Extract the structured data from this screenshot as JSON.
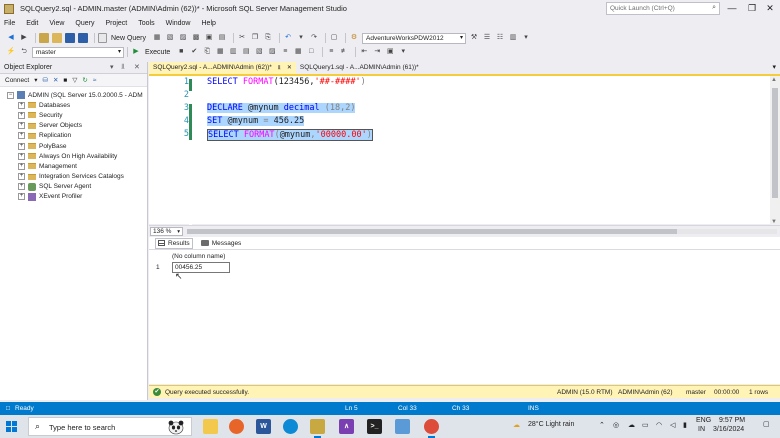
{
  "window": {
    "title": "SQLQuery2.sql - ADMIN.master (ADMIN\\Admin (62))* - Microsoft SQL Server Management Studio",
    "quick_launch_placeholder": "Quick Launch (Ctrl+Q)",
    "controls": [
      "—",
      "❐",
      "✕"
    ]
  },
  "menu": [
    "File",
    "Edit",
    "View",
    "Query",
    "Project",
    "Tools",
    "Window",
    "Help"
  ],
  "toolbar1": {
    "new_query": "New Query",
    "database_combo": "AdventureWorksPDW2012"
  },
  "toolbar2": {
    "db_select": "master",
    "execute": "Execute"
  },
  "object_explorer": {
    "title": "Object Explorer",
    "connect": "Connect",
    "server": "ADMIN (SQL Server 15.0.2000.5 - ADM",
    "nodes": [
      {
        "label": "Databases",
        "icon": "folder"
      },
      {
        "label": "Security",
        "icon": "folder"
      },
      {
        "label": "Server Objects",
        "icon": "folder"
      },
      {
        "label": "Replication",
        "icon": "folder"
      },
      {
        "label": "PolyBase",
        "icon": "folder"
      },
      {
        "label": "Always On High Availability",
        "icon": "folder"
      },
      {
        "label": "Management",
        "icon": "folder"
      },
      {
        "label": "Integration Services Catalogs",
        "icon": "folder"
      },
      {
        "label": "SQL Server Agent",
        "icon": "agent"
      },
      {
        "label": "XEvent Profiler",
        "icon": "xevent"
      }
    ]
  },
  "tabs": [
    {
      "label": "SQLQuery2.sql - A...ADMIN\\Admin (62))*",
      "active": true
    },
    {
      "label": "SQLQuery1.sql - A...ADMIN\\Admin (61))*",
      "active": false
    }
  ],
  "editor": {
    "line_numbers": [
      "1",
      "2",
      "3",
      "4",
      "5"
    ],
    "lines": {
      "l1": {
        "kw": "SELECT",
        "fn": "FORMAT",
        "arg": "(123456,",
        "str": "'##-####'",
        "end": ")"
      },
      "l3": {
        "kw": "DECLARE",
        "var": "@mynum",
        "ty": "decimal",
        "rest": "(18,2)"
      },
      "l4": {
        "kw": "SET",
        "var": "@mynum",
        "op": "=",
        "val": "456.25"
      },
      "l5": {
        "kw": "SELECT",
        "fn": "FORMAT",
        "open": "(",
        "var": "@mynum",
        "comma": ",",
        "str": "'00000.00'",
        "end": ")"
      }
    },
    "zoom": "136 %"
  },
  "results": {
    "tabs": [
      "Results",
      "Messages"
    ],
    "column_header": "(No column name)",
    "rows": [
      {
        "num": "1",
        "value": "00456.25"
      }
    ]
  },
  "query_status": {
    "message": "Query executed successfully.",
    "server": "ADMIN (15.0 RTM)",
    "user": "ADMIN\\Admin (62)",
    "database": "master",
    "elapsed": "00:00:00",
    "rows": "1 rows"
  },
  "statusbar": {
    "ready": "Ready",
    "line": "Ln 5",
    "col": "Col 33",
    "ch": "Ch 33",
    "mode": "INS"
  },
  "taskbar": {
    "search_placeholder": "Type here to search",
    "weather": "28°C  Light rain",
    "lang1": "ENG",
    "lang2": "IN",
    "time": "9:57 PM",
    "date": "3/16/2024"
  }
}
